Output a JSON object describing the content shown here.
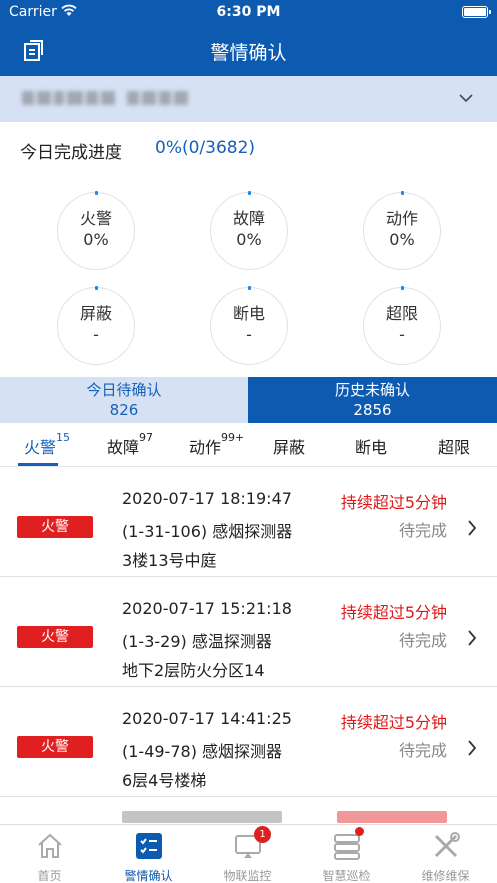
{
  "status_bar": {
    "carrier": "Carrier",
    "time": "6:30 PM"
  },
  "nav": {
    "title": "警情确认",
    "left_icon": "edit-icon"
  },
  "selector": {
    "chevron_icon": "chevron-down-icon"
  },
  "progress": {
    "title": "今日完成进度",
    "value": "0%(0/3682)"
  },
  "stats": [
    {
      "label": "火警",
      "value": "0%"
    },
    {
      "label": "故障",
      "value": "0%"
    },
    {
      "label": "动作",
      "value": "0%"
    },
    {
      "label": "屏蔽",
      "value": "-"
    },
    {
      "label": "断电",
      "value": "-"
    },
    {
      "label": "超限",
      "value": "-"
    }
  ],
  "big_tabs": [
    {
      "label": "今日待确认",
      "count": "826",
      "active": false
    },
    {
      "label": "历史未确认",
      "count": "2856",
      "active": true
    }
  ],
  "category_tabs": [
    {
      "label": "火警",
      "count": "15",
      "active": true
    },
    {
      "label": "故障",
      "count": "97"
    },
    {
      "label": "动作",
      "count": "99+"
    },
    {
      "label": "屏蔽",
      "count": ""
    },
    {
      "label": "断电",
      "count": ""
    },
    {
      "label": "超限",
      "count": ""
    }
  ],
  "alarms": [
    {
      "type": "火警",
      "time": "2020-07-17 18:19:47",
      "device": "(1-31-106)  感烟探测器",
      "location": "3楼13号中庭",
      "overdue": "持续超过5分钟",
      "status": "待完成"
    },
    {
      "type": "火警",
      "time": "2020-07-17 15:21:18",
      "device": "(1-3-29)  感温探测器",
      "location": "地下2层防火分区14",
      "overdue": "持续超过5分钟",
      "status": "待完成"
    },
    {
      "type": "火警",
      "time": "2020-07-17 14:41:25",
      "device": "(1-49-78)  感烟探测器",
      "location": "6层4号楼梯",
      "overdue": "持续超过5分钟",
      "status": "待完成"
    }
  ],
  "tabbar": [
    {
      "label": "首页",
      "icon": "home-icon"
    },
    {
      "label": "警情确认",
      "icon": "checklist-icon",
      "active": true
    },
    {
      "label": "物联监控",
      "icon": "monitor-icon",
      "badge": "1"
    },
    {
      "label": "智慧巡检",
      "icon": "inspection-icon",
      "dot": true
    },
    {
      "label": "维修维保",
      "icon": "tools-icon"
    }
  ],
  "colors": {
    "primary": "#0d5bb0",
    "accent_blue": "#1560b8",
    "alarm_red": "#e02020",
    "light_blue_bg": "#d6e2f4"
  }
}
